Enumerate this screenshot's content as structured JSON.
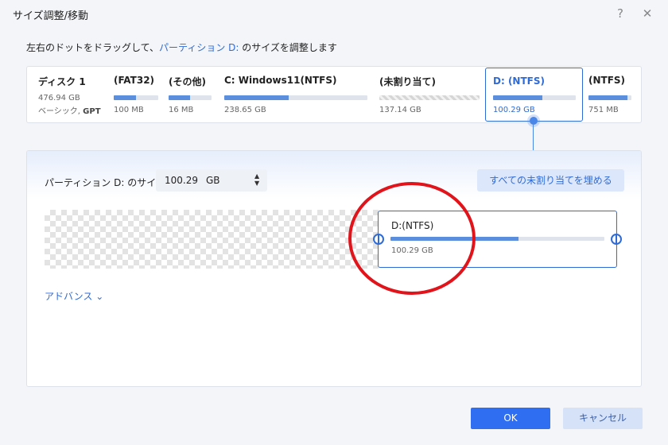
{
  "window": {
    "title": "サイズ調整/移動",
    "help": "?",
    "close": "✕"
  },
  "instruction": {
    "prefix": "左右のドットをドラッグして、",
    "highlight": "パーティション D:",
    "suffix": " のサイズを調整します"
  },
  "disk": {
    "name": "ディスク 1",
    "size": "476.94 GB",
    "type_prefix": "ベーシック, ",
    "type_bold": "GPT"
  },
  "partitions": [
    {
      "name": "(FAT32)",
      "size": "100 MB",
      "used_fraction": 0.5
    },
    {
      "name": "(その他)",
      "size": "16 MB",
      "used_fraction": 0.5
    },
    {
      "name": "C: Windows11(NTFS)",
      "size": "238.65 GB",
      "used_fraction": 0.45
    },
    {
      "name": "(未割り当て)",
      "size": "137.14 GB",
      "used_fraction": 0
    },
    {
      "name": "D: (NTFS)",
      "size": "100.29 GB",
      "used_fraction": 0.6
    },
    {
      "name": "(NTFS)",
      "size": "751 MB",
      "used_fraction": 0.9
    }
  ],
  "resize": {
    "label": "パーティション D: のサイズ",
    "value": "100.29",
    "unit": "GB",
    "fill_button": "すべての未割り当てを埋める",
    "partition_name": "D:(NTFS)",
    "partition_size": "100.29 GB",
    "used_fraction": 0.6
  },
  "advanced": {
    "label": "アドバンス",
    "chevron": "⌄"
  },
  "buttons": {
    "ok": "OK",
    "cancel": "キャンセル"
  },
  "colors": {
    "accent": "#2f6bd6",
    "annotation": "#e1141b"
  }
}
